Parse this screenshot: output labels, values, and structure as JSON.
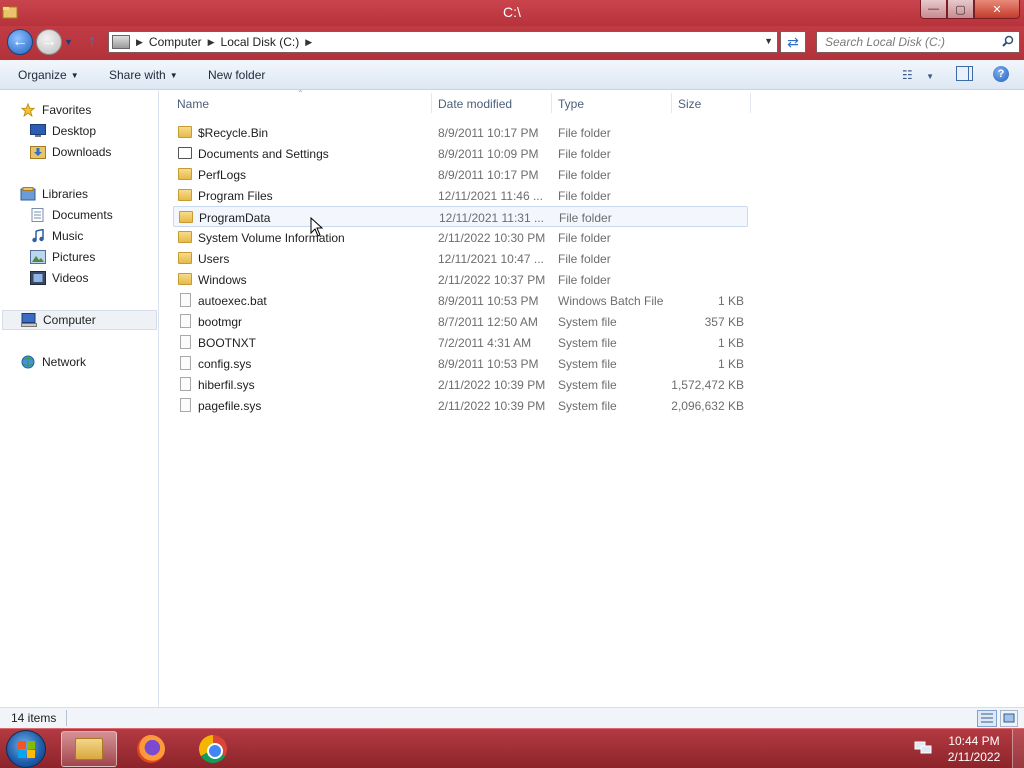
{
  "window": {
    "title": "C:\\",
    "controls": {
      "minimize": "—",
      "maximize": "▢",
      "close": "✕"
    }
  },
  "address": {
    "breadcrumbs": [
      "Computer",
      "Local Disk (C:)"
    ],
    "search_placeholder": "Search Local Disk (C:)"
  },
  "toolbar": {
    "organize": "Organize",
    "share_with": "Share with",
    "new_folder": "New folder"
  },
  "nav": {
    "favorites": {
      "label": "Favorites",
      "items": [
        "Desktop",
        "Downloads"
      ]
    },
    "libraries": {
      "label": "Libraries",
      "items": [
        "Documents",
        "Music",
        "Pictures",
        "Videos"
      ]
    },
    "computer": "Computer",
    "network": "Network"
  },
  "columns": {
    "name": "Name",
    "date": "Date modified",
    "type": "Type",
    "size": "Size"
  },
  "files": [
    {
      "name": "$Recycle.Bin",
      "date": "8/9/2011 10:17 PM",
      "type": "File folder",
      "size": "",
      "icon": "folder-icon"
    },
    {
      "name": "Documents and Settings",
      "date": "8/9/2011 10:09 PM",
      "type": "File folder",
      "size": "",
      "icon": "shortcut-folder-icon"
    },
    {
      "name": "PerfLogs",
      "date": "8/9/2011 10:17 PM",
      "type": "File folder",
      "size": "",
      "icon": "folder-icon"
    },
    {
      "name": "Program Files",
      "date": "12/11/2021 11:46 ...",
      "type": "File folder",
      "size": "",
      "icon": "folder-icon"
    },
    {
      "name": "ProgramData",
      "date": "12/11/2021 11:31 ...",
      "type": "File folder",
      "size": "",
      "icon": "folder-icon"
    },
    {
      "name": "System Volume Information",
      "date": "2/11/2022 10:30 PM",
      "type": "File folder",
      "size": "",
      "icon": "folder-icon"
    },
    {
      "name": "Users",
      "date": "12/11/2021 10:47 ...",
      "type": "File folder",
      "size": "",
      "icon": "folder-icon"
    },
    {
      "name": "Windows",
      "date": "2/11/2022 10:37 PM",
      "type": "File folder",
      "size": "",
      "icon": "folder-icon"
    },
    {
      "name": "autoexec.bat",
      "date": "8/9/2011 10:53 PM",
      "type": "Windows Batch File",
      "size": "1 KB",
      "icon": "batch-file-icon"
    },
    {
      "name": "bootmgr",
      "date": "8/7/2011 12:50 AM",
      "type": "System file",
      "size": "357 KB",
      "icon": "system-file-icon"
    },
    {
      "name": "BOOTNXT",
      "date": "7/2/2011 4:31 AM",
      "type": "System file",
      "size": "1 KB",
      "icon": "system-file-icon"
    },
    {
      "name": "config.sys",
      "date": "8/9/2011 10:53 PM",
      "type": "System file",
      "size": "1 KB",
      "icon": "system-file-icon"
    },
    {
      "name": "hiberfil.sys",
      "date": "2/11/2022 10:39 PM",
      "type": "System file",
      "size": "1,572,472 KB",
      "icon": "system-file-icon"
    },
    {
      "name": "pagefile.sys",
      "date": "2/11/2022 10:39 PM",
      "type": "System file",
      "size": "2,096,632 KB",
      "icon": "system-file-icon"
    }
  ],
  "status": {
    "item_count": "14 items"
  },
  "taskbar": {
    "time": "10:44 PM",
    "date": "2/11/2022",
    "apps": [
      "windows-explorer-icon",
      "firefox-icon",
      "chrome-icon"
    ]
  },
  "colors": {
    "accent": "#b8323b",
    "selection": "#f3f7fd",
    "link_text": "#4c607a"
  }
}
